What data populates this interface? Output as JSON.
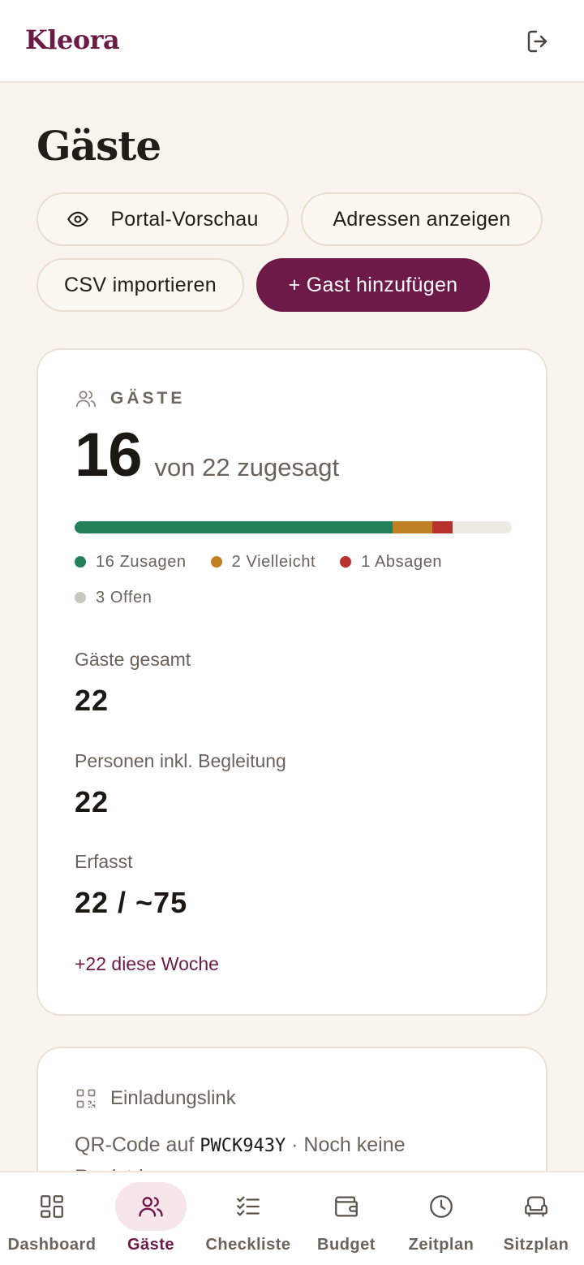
{
  "app": {
    "logo": "Kleora"
  },
  "page": {
    "title": "Gäste"
  },
  "actions": {
    "portal_preview": "Portal-Vorschau",
    "show_addresses": "Adressen anzeigen",
    "import_csv": "CSV importieren",
    "add_guest": "+ Gast hinzufügen"
  },
  "guests_card": {
    "label": "GÄSTE",
    "confirmed": "16",
    "confirmed_suffix": "von 22 zugesagt",
    "progress": {
      "total": 22,
      "segments": [
        {
          "key": "zusagen",
          "count": 16,
          "color": "#23815a"
        },
        {
          "key": "vielleicht",
          "count": 2,
          "color": "#c08125"
        },
        {
          "key": "absagen",
          "count": 1,
          "color": "#b8322d"
        }
      ],
      "empty_color": "#eeebe5"
    },
    "legend": [
      {
        "label": "16 Zusagen",
        "color": "#23815a"
      },
      {
        "label": "2 Vielleicht",
        "color": "#c08125"
      },
      {
        "label": "1 Absagen",
        "color": "#b8322d"
      },
      {
        "label": "3 Offen",
        "color": "#c9c6c1"
      }
    ],
    "stats": {
      "total_label": "Gäste gesamt",
      "total_value": "22",
      "persons_label": "Personen inkl. Begleitung",
      "persons_value": "22",
      "recorded_label": "Erfasst",
      "recorded_value": "22 / ~75"
    },
    "week_note": "+22 diese Woche"
  },
  "invite_card": {
    "title": "Einladungslink",
    "desc_prefix": "QR-Code auf ",
    "code": "PWCK943Y",
    "desc_suffix": " · Noch keine Registrierungen"
  },
  "nav": {
    "dashboard": "Dashboard",
    "guests": "Gäste",
    "checklist": "Checkliste",
    "budget": "Budget",
    "timeline": "Zeitplan",
    "seating": "Sitzplan"
  },
  "icons": {
    "logout": "logout-icon",
    "eye": "eye-icon",
    "users": "users-icon",
    "qr": "qr-code-icon",
    "dashboard": "dashboard-grid-icon",
    "checklist": "checklist-icon",
    "wallet": "wallet-icon",
    "clock": "clock-icon",
    "sofa": "sofa-icon"
  },
  "colors": {
    "brand": "#6e1a48",
    "background": "#f9f4ed",
    "active_nav_bg": "#f6e5ea"
  }
}
